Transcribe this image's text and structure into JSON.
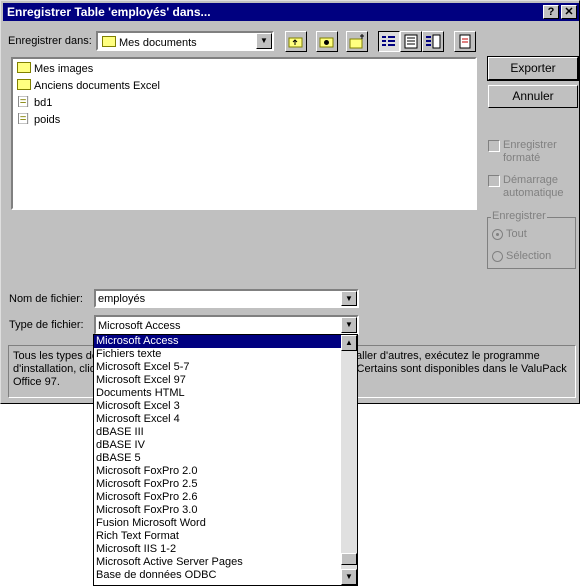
{
  "window": {
    "title": "Enregistrer Table 'employés' dans...",
    "help_btn": "?",
    "close_btn": "✕"
  },
  "save_in": {
    "label": "Enregistrer dans:",
    "value": "Mes documents"
  },
  "files": [
    {
      "name": "Mes images",
      "icon": "folder-icon"
    },
    {
      "name": "Anciens documents Excel",
      "icon": "folder-icon"
    },
    {
      "name": "bd1",
      "icon": "database-file-icon"
    },
    {
      "name": "poids",
      "icon": "database-file-icon"
    }
  ],
  "buttons": {
    "export": "Exporter",
    "cancel": "Annuler"
  },
  "options": {
    "save_formatted": "Enregistrer formaté",
    "autostart": "Démarrage automatique",
    "group_title": "Enregistrer",
    "all": "Tout",
    "selection": "Sélection"
  },
  "filename": {
    "label": "Nom de fichier:",
    "value": "employés"
  },
  "filetype": {
    "label": "Type de fichier:",
    "value": "Microsoft Access",
    "options": [
      "Microsoft Access",
      "Fichiers texte",
      "Microsoft Excel 5-7",
      "Microsoft Excel 97",
      "Documents HTML",
      "Microsoft Excel 3",
      "Microsoft Excel 4",
      "dBASE III",
      "dBASE IV",
      "dBASE 5",
      "Microsoft FoxPro 2.0",
      "Microsoft FoxPro 2.5",
      "Microsoft FoxPro 2.6",
      "Microsoft FoxPro 3.0",
      "Fusion Microsoft Word",
      "Rich Text Format",
      "Microsoft IIS 1-2",
      "Microsoft Active Server Pages",
      "Base de données ODBC"
    ],
    "selected_index": 0
  },
  "info": {
    "text": "Tous les types de fichiers ne sont pas installés par défaut. Pour en installer d'autres, exécutez le programme d'installation, cliquez sur Ajouter/Supprimer, puis sélectionnez l'option. Certains sont disponibles dans le ValuPack Office 97."
  },
  "colors": {
    "title_bar": "#000080",
    "dialog": "#c0c0c0",
    "selection": "#000080"
  }
}
